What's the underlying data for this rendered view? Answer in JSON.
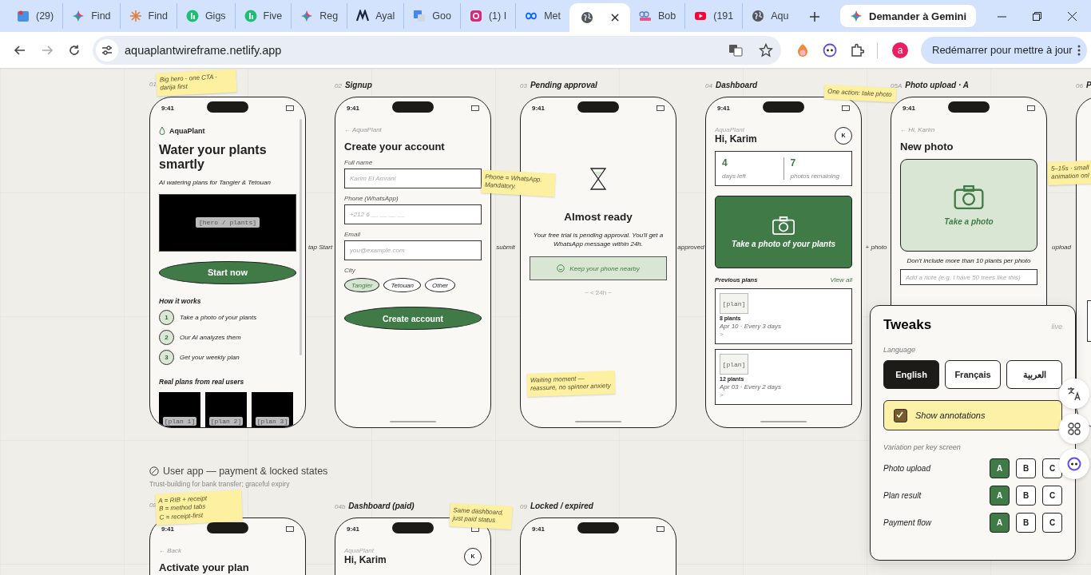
{
  "browser": {
    "tabs": [
      {
        "kind": "map",
        "title": "(29)",
        "selected": false
      },
      {
        "kind": "sparkle",
        "title": "Find",
        "selected": false
      },
      {
        "kind": "burst",
        "title": "Find",
        "selected": false
      },
      {
        "kind": "green",
        "title": "Gigs",
        "selected": false
      },
      {
        "kind": "green",
        "title": "Five",
        "selected": false
      },
      {
        "kind": "sparkle",
        "title": "Reg",
        "selected": false
      },
      {
        "kind": "dark",
        "title": "Ayal",
        "selected": false
      },
      {
        "kind": "translate",
        "title": "Goo",
        "selected": false
      },
      {
        "kind": "camera",
        "title": "(1) I",
        "selected": false
      },
      {
        "kind": "infinity",
        "title": "Met",
        "selected": false
      },
      {
        "kind": "globe",
        "selected": true
      },
      {
        "kind": "bob",
        "title": "Bob",
        "selected": false
      },
      {
        "kind": "play",
        "title": "(191",
        "selected": false
      },
      {
        "kind": "globe",
        "title": "Aqu",
        "selected": false
      }
    ],
    "gemini_button": "Demander à Gemini",
    "url": "aquaplantwireframe.netlify.app",
    "profile_initial": "a",
    "update_button": "Redémarrer pour mettre à jour"
  },
  "canvas": {
    "screens": [
      {
        "number": "01",
        "kind": "landing",
        "time": "9:41",
        "brand": "AquaPlant",
        "headline": "Water your plants smartly",
        "tagline": "AI watering plans for Tangier & Tetouan",
        "hero_label": "[hero / plants]",
        "cta": "Start now",
        "steps_title": "How it works",
        "steps": [
          {
            "number": "1",
            "text": "Take a photo of your plants"
          },
          {
            "number": "2",
            "text": "Our AI analyzes them"
          },
          {
            "number": "3",
            "text": "Get your weekly plan"
          }
        ],
        "gallery_title": "Real plans from real users",
        "gallery": [
          "[plan 1]",
          "[plan 2]",
          "[plan 3]"
        ]
      },
      {
        "number": "02",
        "title": "Signup",
        "kind": "signup",
        "time": "9:41",
        "back": "← AquaPlant",
        "heading": "Create your account",
        "fields": [
          {
            "label": "Full name",
            "placeholder": "Karim El Amrani"
          },
          {
            "label": "Phone (WhatsApp)",
            "placeholder": "+212 6 __ __ __ __"
          },
          {
            "label": "Email",
            "placeholder": "you@example.com"
          }
        ],
        "city_label": "City",
        "cities": [
          {
            "label": "Tangier",
            "selected": true
          },
          {
            "label": "Tetouan",
            "selected": false
          },
          {
            "label": "Other",
            "selected": false
          }
        ],
        "submit": "Create account"
      },
      {
        "number": "03",
        "title": "Pending approval",
        "kind": "pending",
        "time": "9:41",
        "heading": "Almost ready",
        "message": "Your free trial is pending approval. You'll get a WhatsApp message within 24h.",
        "notice": "Keep your phone nearby",
        "eta": "~ < 24h ~"
      },
      {
        "number": "04",
        "title": "Dashboard",
        "kind": "dashboard",
        "time": "9:41",
        "brand": "AquaPlant",
        "greeting": "Hi, Karim",
        "avatar": "K",
        "stats": [
          {
            "value": "4",
            "label": "days left"
          },
          {
            "value": "7",
            "label": "photos remaining"
          }
        ],
        "action": "Take a photo of your plants",
        "plans_title": "Previous plans",
        "view_all": "View all",
        "plans": [
          {
            "thumb": "[plan]",
            "title": "8 plants",
            "detail": "Apr 10 · Every 3 days",
            "chevron": ">"
          },
          {
            "thumb": "[plan]",
            "title": "12 plants",
            "detail": "Apr 03 · Every 2 days",
            "chevron": ">"
          }
        ]
      },
      {
        "number": "05A",
        "title": "Photo upload · A",
        "kind": "photo_upload",
        "time": "9:41",
        "back": "← Hi, Karim",
        "heading": "New photo",
        "action": "Take a photo",
        "hint": "Don't include more than 10 plants per photo",
        "note_placeholder": "Add a note (e.g. I have 50 trees like this)"
      },
      {
        "number": "06",
        "title": "P",
        "kind": "partial"
      }
    ],
    "flow_labels": [
      "tap Start",
      "submit",
      "approved",
      "+ photo",
      "upload"
    ],
    "notes": [
      {
        "text": "Big hero · one CTA · darija first"
      },
      {
        "text": "Phone = WhatsApp. Mandatory."
      },
      {
        "text": "One action: take photo"
      },
      {
        "text": "5–15s · small\nanimation onl"
      },
      {
        "text": "Waiting moment — reassure, no spinner anxiety"
      }
    ],
    "section": {
      "title": "User app — payment & locked states",
      "subtitle": "Trust-building for bank transfer; graceful expiry"
    },
    "lower_screens": [
      {
        "number": "08",
        "kind": "payment",
        "time": "9:41",
        "back": "← Back",
        "heading": "Activate your plan"
      },
      {
        "number": "04b",
        "title": "Dashboard (paid)",
        "kind": "dashboard_paid",
        "time": "9:41",
        "brand": "AquaPlant",
        "greeting": "Hi, Karim",
        "avatar": "K"
      },
      {
        "number": "09",
        "title": "Locked / expired",
        "kind": "locked",
        "time": "9:41"
      }
    ],
    "lower_notes": [
      {
        "text": "A = RIB + receipt\nB = method tabs\nC = receipt-first"
      },
      {
        "text": "Same dashboard,\njust paid status"
      }
    ]
  },
  "tweaks": {
    "title": "Tweaks",
    "status": "live",
    "language_label": "Language",
    "languages": [
      {
        "label": "English",
        "selected": true
      },
      {
        "label": "Français",
        "selected": false
      },
      {
        "label": "العربية",
        "selected": false
      }
    ],
    "annotations": {
      "label": "Show annotations",
      "checked": true
    },
    "variation_label": "Variation per key screen",
    "variations": [
      {
        "screen": "Photo upload",
        "options": [
          {
            "label": "A",
            "selected": true
          },
          {
            "label": "B",
            "selected": false
          },
          {
            "label": "C",
            "selected": false
          }
        ]
      },
      {
        "screen": "Plan result",
        "options": [
          {
            "label": "A",
            "selected": true
          },
          {
            "label": "B",
            "selected": false
          },
          {
            "label": "C",
            "selected": false
          }
        ]
      },
      {
        "screen": "Payment flow",
        "options": [
          {
            "label": "A",
            "selected": true
          },
          {
            "label": "B",
            "selected": false
          },
          {
            "label": "C",
            "selected": false
          }
        ]
      }
    ]
  }
}
